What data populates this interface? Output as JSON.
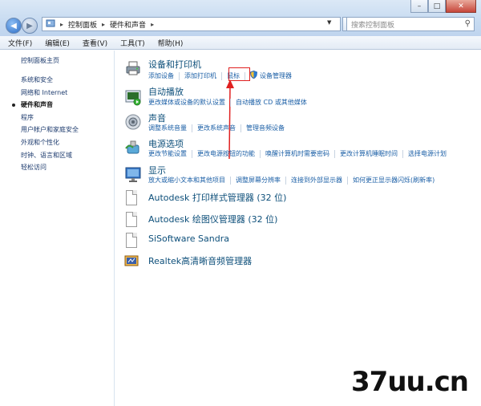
{
  "window": {
    "buttons": {
      "minimize": "–",
      "maximize": "□",
      "close": "✕"
    }
  },
  "address": {
    "crumbs": [
      "控制面板",
      "硬件和声音"
    ],
    "search_placeholder": "搜索控制面板"
  },
  "menu": [
    "文件(F)",
    "编辑(E)",
    "查看(V)",
    "工具(T)",
    "帮助(H)"
  ],
  "sidebar": {
    "items": [
      {
        "label": "控制面板主页"
      },
      {
        "label": "系统和安全"
      },
      {
        "label": "网络和 Internet"
      },
      {
        "label": "硬件和声音"
      },
      {
        "label": "程序"
      },
      {
        "label": "用户帐户和家庭安全"
      },
      {
        "label": "外观和个性化"
      },
      {
        "label": "时钟、语言和区域"
      },
      {
        "label": "轻松访问"
      }
    ]
  },
  "categories": [
    {
      "title": "设备和打印机",
      "links": [
        "添加设备",
        "添加打印机",
        "鼠标",
        "设备管理器"
      ]
    },
    {
      "title": "自动播放",
      "links": [
        "更改媒体或设备的默认设置",
        "自动播放 CD 或其他媒体"
      ]
    },
    {
      "title": "声音",
      "links": [
        "调整系统音量",
        "更改系统声音",
        "管理音频设备"
      ]
    },
    {
      "title": "电源选项",
      "links": [
        "更改节能设置",
        "更改电源按钮的功能",
        "唤醒计算机时需要密码",
        "更改计算机睡眠时间",
        "选择电源计划"
      ]
    },
    {
      "title": "显示",
      "links": [
        "放大或缩小文本和其他项目",
        "调整屏幕分辨率",
        "连接到外部显示器",
        "如何更正显示器闪烁(刷新率)"
      ]
    }
  ],
  "programs": [
    {
      "label": "Autodesk 打印样式管理器 (32 位)"
    },
    {
      "label": "Autodesk 绘图仪管理器 (32 位)"
    },
    {
      "label": "SiSoftware Sandra"
    },
    {
      "label": "Realtek高清晰音频管理器"
    }
  ],
  "watermark": "37uu.cn",
  "colors": {
    "link": "#1b5fa6",
    "title": "#0d4f7a",
    "highlight": "#e02020"
  }
}
